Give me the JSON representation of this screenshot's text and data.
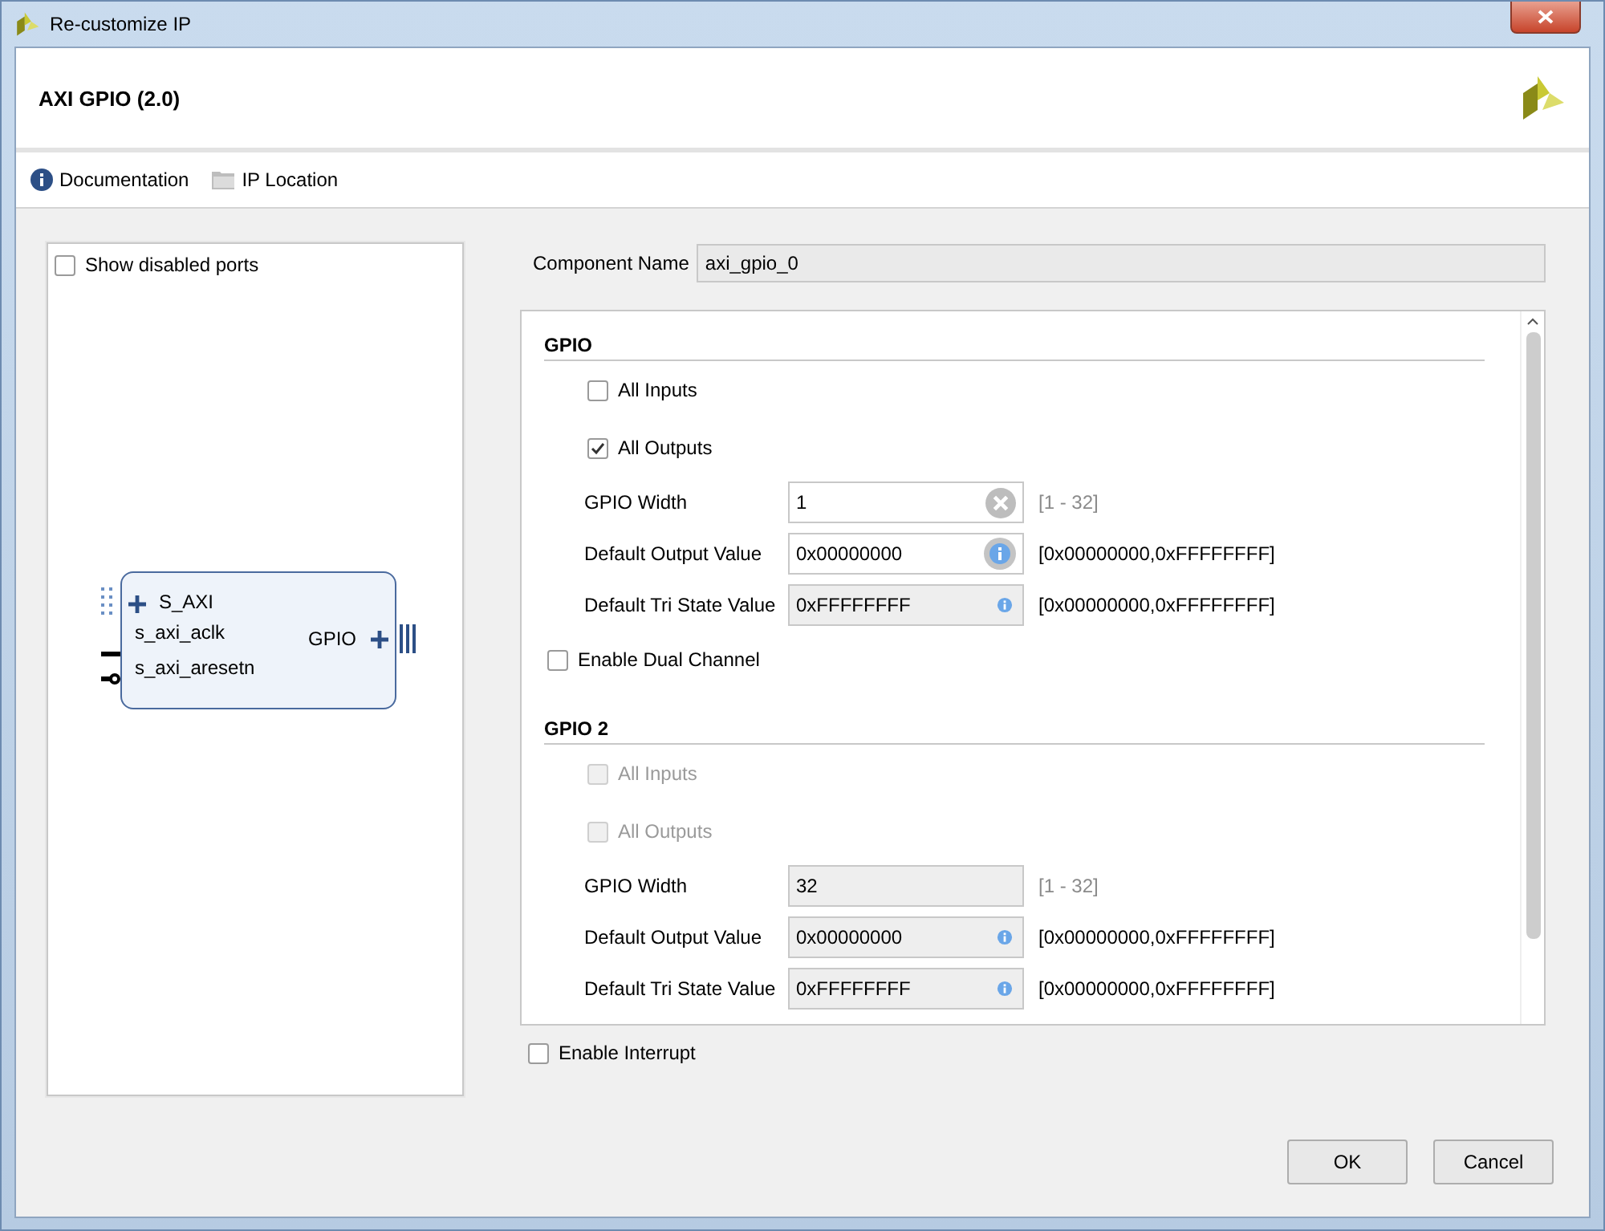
{
  "window": {
    "title": "Re-customize IP"
  },
  "header": {
    "title": "AXI GPIO (2.0)"
  },
  "toolbar": [
    {
      "kind": "info",
      "label": "Documentation"
    },
    {
      "kind": "folder",
      "label": "IP Location"
    }
  ],
  "left_panel": {
    "show_disabled_ports": {
      "label": "Show disabled ports",
      "checked": false
    },
    "block": {
      "ports_left": [
        {
          "kind": "bus",
          "label": "S_AXI"
        },
        {
          "kind": "clock",
          "label": "s_axi_aclk"
        },
        {
          "kind": "reset",
          "label": "s_axi_aresetn"
        }
      ],
      "ports_right": [
        {
          "kind": "bus",
          "label": "GPIO"
        }
      ]
    }
  },
  "component_name": {
    "label": "Component Name",
    "value": "axi_gpio_0"
  },
  "panel": [
    {
      "kind": "heading",
      "label": "GPIO"
    },
    {
      "kind": "checkbox",
      "label": "All Inputs",
      "checked": false,
      "disabled": false
    },
    {
      "kind": "checkbox",
      "label": "All Outputs",
      "checked": true,
      "disabled": false
    },
    {
      "kind": "field",
      "label": "GPIO Width",
      "value": "1",
      "disabled": false,
      "adornment": {
        "kind": "clear"
      },
      "hint": "[1 - 32]"
    },
    {
      "kind": "field",
      "label": "Default Output Value",
      "value": "0x00000000",
      "disabled": false,
      "adornment": {
        "kind": "info",
        "hovered": true
      },
      "hint": "[0x00000000,0xFFFFFFFF]"
    },
    {
      "kind": "field",
      "label": "Default Tri State Value",
      "value": "0xFFFFFFFF",
      "disabled": true,
      "adornment": {
        "kind": "info",
        "hovered": false
      },
      "hint": "[0x00000000,0xFFFFFFFF]"
    },
    {
      "kind": "option",
      "label": "Enable Dual Channel",
      "checked": false,
      "disabled": false
    },
    {
      "kind": "heading",
      "label": "GPIO 2"
    },
    {
      "kind": "checkbox",
      "label": "All Inputs",
      "checked": false,
      "disabled": true
    },
    {
      "kind": "checkbox",
      "label": "All Outputs",
      "checked": false,
      "disabled": true
    },
    {
      "kind": "field",
      "label": "GPIO Width",
      "value": "32",
      "disabled": true,
      "hint": "[1 - 32]"
    },
    {
      "kind": "field",
      "label": "Default Output Value",
      "value": "0x00000000",
      "disabled": true,
      "adornment": {
        "kind": "info",
        "hovered": false
      },
      "hint": "[0x00000000,0xFFFFFFFF]"
    },
    {
      "kind": "field",
      "label": "Default Tri State Value",
      "value": "0xFFFFFFFF",
      "disabled": true,
      "adornment": {
        "kind": "info",
        "hovered": false
      },
      "hint": "[0x00000000,0xFFFFFFFF]"
    }
  ],
  "enable_interrupt": {
    "label": "Enable Interrupt",
    "checked": false
  },
  "buttons": [
    {
      "label": "OK"
    },
    {
      "label": "Cancel"
    }
  ]
}
